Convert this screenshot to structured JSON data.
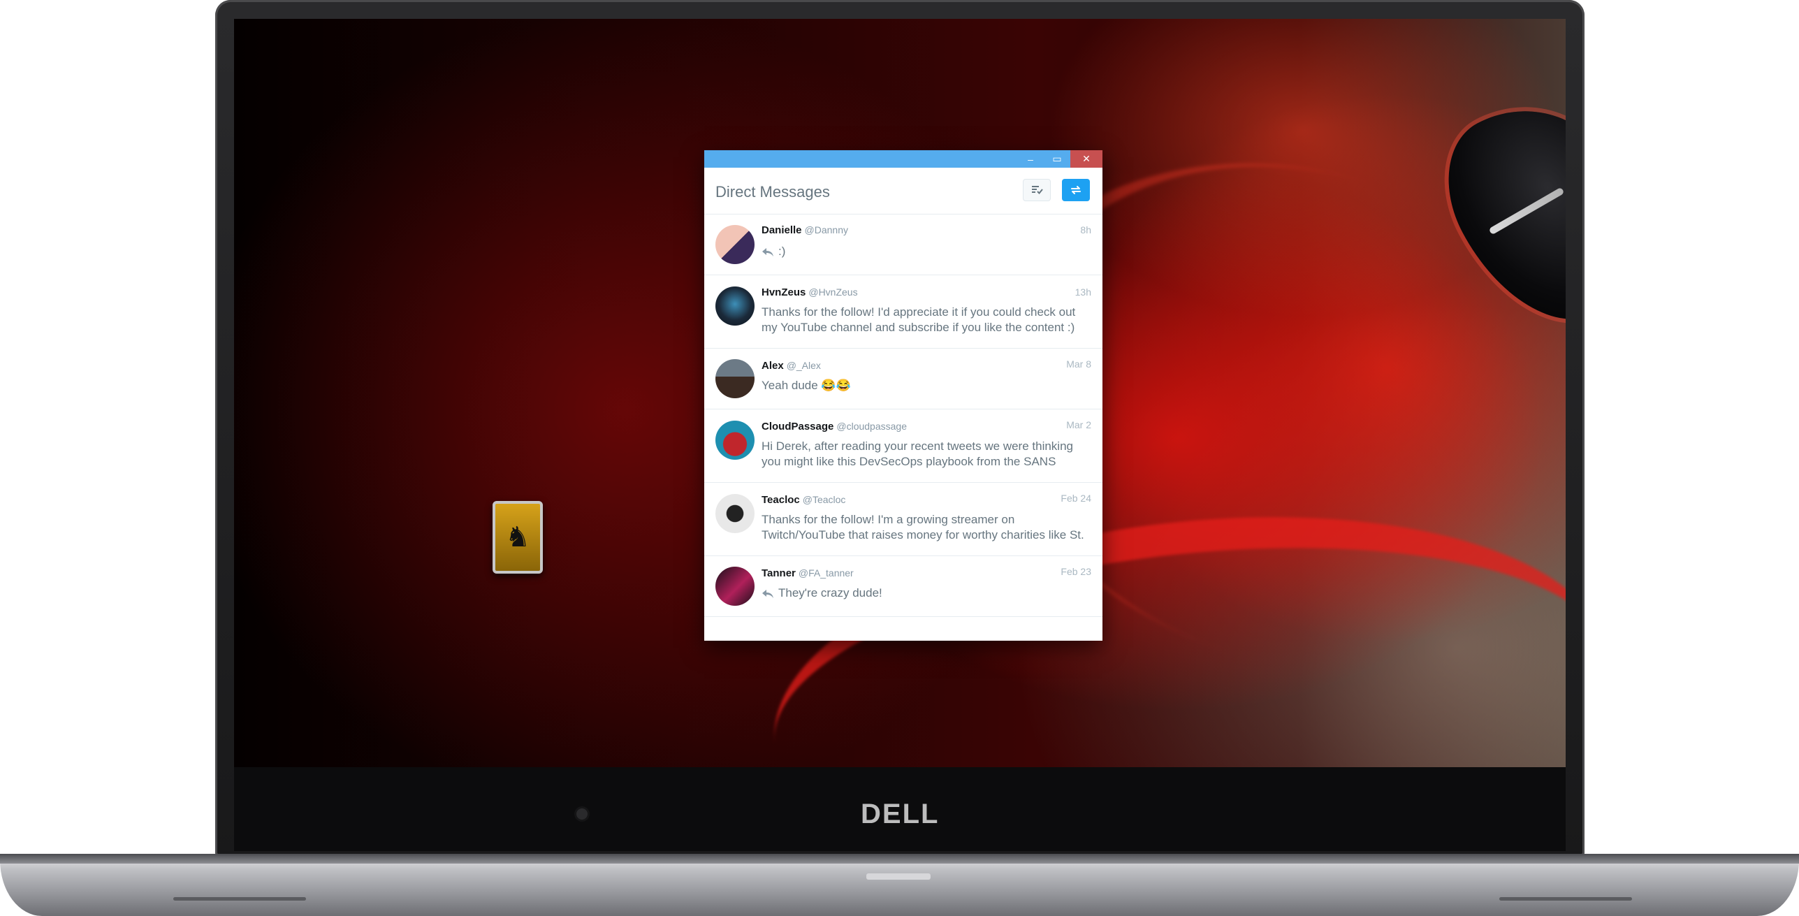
{
  "hardware": {
    "brand_logo": "DELL"
  },
  "window": {
    "controls": {
      "minimize": "–",
      "maximize": "▭",
      "close": "✕"
    },
    "title": "Direct Messages",
    "mark_all_read_icon": "mark-read-icon",
    "new_message_icon": "new-message-icon"
  },
  "conversations": [
    {
      "name": "Danielle",
      "handle": "@Dannny",
      "time": "8h",
      "message": ":)",
      "replied": true,
      "avatar_colors": [
        "#f2c4b6",
        "#3a2a5a"
      ]
    },
    {
      "name": "HvnZeus",
      "handle": "@HvnZeus",
      "time": "13h",
      "message": "Thanks for the follow! I'd appreciate it if you could check out my YouTube channel and subscribe if you like the content :)",
      "replied": false,
      "avatar_colors": [
        "#1b2a3a",
        "#3d8fb8"
      ]
    },
    {
      "name": "Alex",
      "handle": "@_Alex",
      "time": "Mar 8",
      "message": "Yeah dude 😂😂",
      "replied": false,
      "avatar_colors": [
        "#6c7a86",
        "#3b2a22"
      ]
    },
    {
      "name": "CloudPassage",
      "handle": "@cloudpassage",
      "time": "Mar 2",
      "message": "Hi Derek, after reading your recent tweets we were thinking you might like this DevSecOps playbook from the SANS",
      "replied": false,
      "avatar_colors": [
        "#1e8fb0",
        "#c0262c"
      ]
    },
    {
      "name": "Teacloc",
      "handle": "@Teacloc",
      "time": "Feb 24",
      "message": "Thanks for the follow! I'm a growing streamer on Twitch/YouTube that raises money for worthy charities like St.",
      "replied": false,
      "avatar_colors": [
        "#e8e8e8",
        "#222222"
      ]
    },
    {
      "name": "Tanner",
      "handle": "@FA_tanner",
      "time": "Feb 23",
      "message": "They're crazy dude!",
      "replied": true,
      "avatar_colors": [
        "#1a0f1a",
        "#b0205a"
      ]
    }
  ]
}
